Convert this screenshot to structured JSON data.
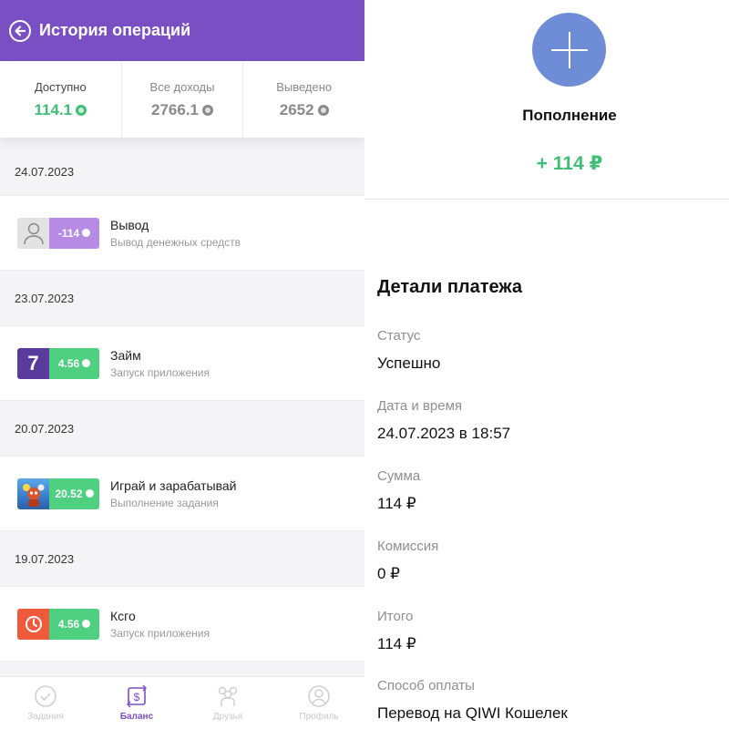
{
  "history": {
    "title": "История операций",
    "stats": [
      {
        "label": "Доступно",
        "value": "114.1"
      },
      {
        "label": "Все доходы",
        "value": "2766.1"
      },
      {
        "label": "Выведено",
        "value": "2652"
      }
    ],
    "groups": [
      {
        "date": "24.07.2023",
        "title": "Вывод",
        "subtitle": "Вывод денежных средств",
        "amount": "-114"
      },
      {
        "date": "23.07.2023",
        "title": "Займ",
        "subtitle": "Запуск приложения",
        "amount": "4.56",
        "thumb_text": "7"
      },
      {
        "date": "20.07.2023",
        "title": "Играй и зарабатывай",
        "subtitle": "Выполнение задания",
        "amount": "20.52"
      },
      {
        "date": "19.07.2023",
        "title": "Ксго",
        "subtitle": "Запуск приложения",
        "amount": "4.56"
      }
    ],
    "tabs": [
      {
        "label": "Задания",
        "icon": "check-icon"
      },
      {
        "label": "Баланс",
        "icon": "balance-icon"
      },
      {
        "label": "Друзья",
        "icon": "friends-icon"
      },
      {
        "label": "Профиль",
        "icon": "profile-icon"
      }
    ],
    "active_tab": "Баланс"
  },
  "payment": {
    "icon": "plus-icon",
    "title": "Пополнение",
    "amount": "+ 114 ₽",
    "details_title": "Детали платежа",
    "fields": [
      {
        "label": "Статус",
        "value": "Успешно"
      },
      {
        "label": "Дата и время",
        "value": "24.07.2023 в 18:57"
      },
      {
        "label": "Сумма",
        "value": "114 ₽"
      },
      {
        "label": "Комиссия",
        "value": "0 ₽"
      },
      {
        "label": "Итого",
        "value": "114 ₽"
      },
      {
        "label": "Способ оплаты",
        "value": "Перевод на QIWI Кошелек"
      }
    ]
  },
  "colors": {
    "header": "#7b4fc4",
    "income_green": "#3fbf76",
    "withdraw_badge": "#b58be6",
    "income_badge": "#4ed080",
    "plus_circle": "#6f8dd6"
  }
}
